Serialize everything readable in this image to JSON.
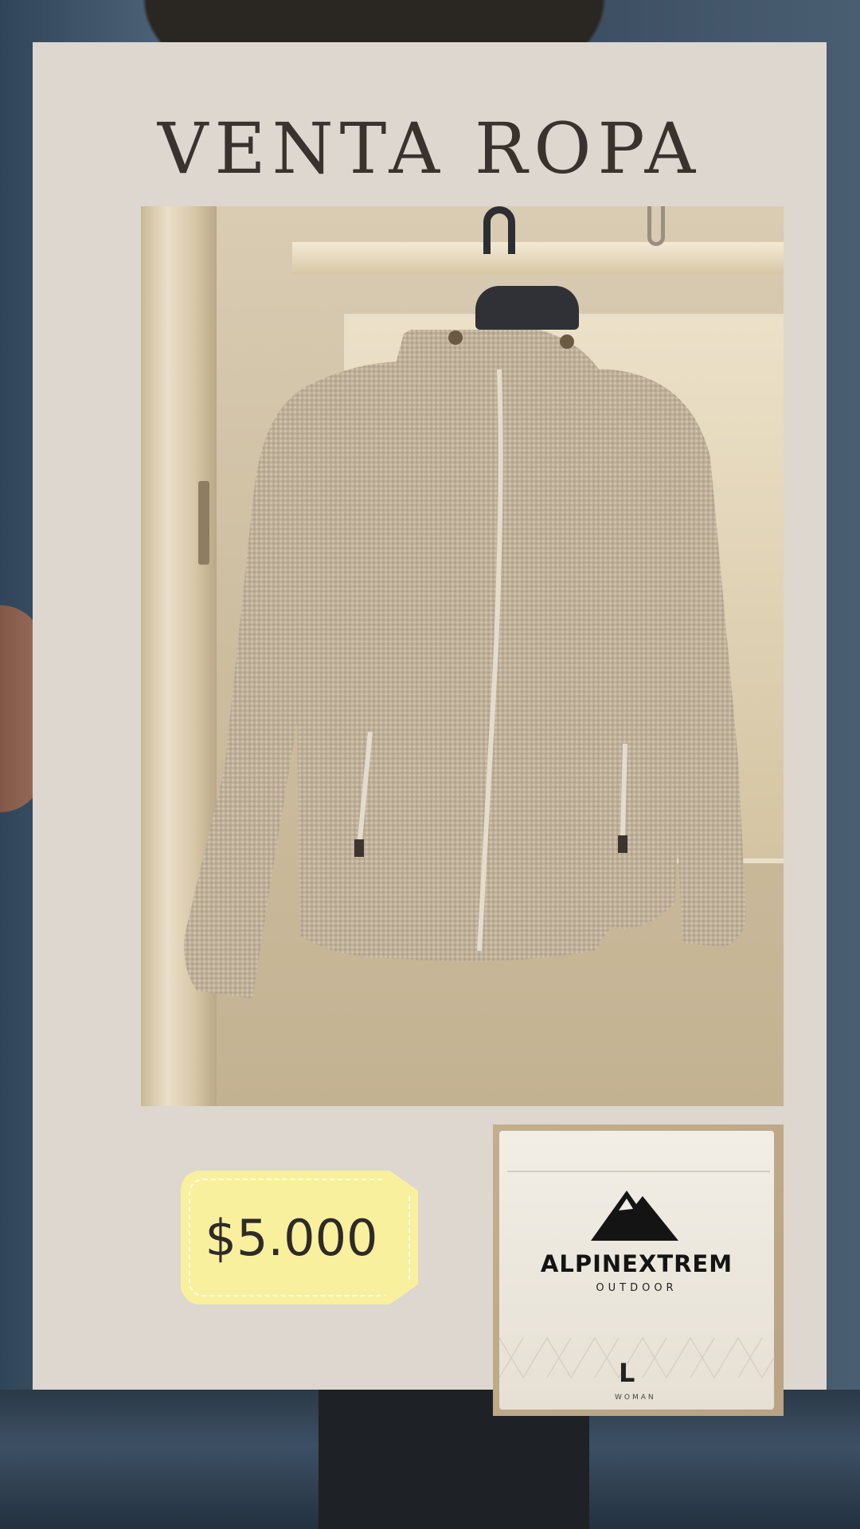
{
  "title": "VENTA ROPA",
  "price": "$5.000",
  "label": {
    "brand": "ALPINEXTREM",
    "brand_sub": "OUTDOOR",
    "size": "L",
    "size_sub": "WOMAN"
  },
  "colors": {
    "card_bg": "#ddd7cf",
    "title_text": "#3a322e",
    "price_tag": "#f8f09d"
  }
}
